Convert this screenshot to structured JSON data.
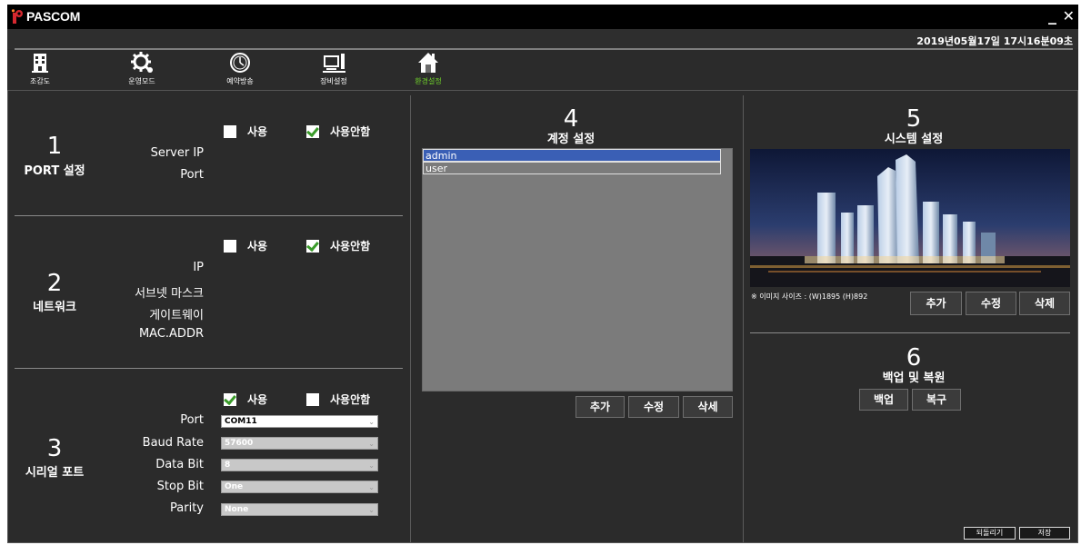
{
  "app": {
    "logo": "PASCOM",
    "minimize": "_",
    "close": "✕",
    "datetime": "2019년05월17일 17시16분09초"
  },
  "nav": {
    "items": [
      {
        "label": "조감도",
        "icon": "building-icon"
      },
      {
        "label": "운영모드",
        "icon": "gear-icon"
      },
      {
        "label": "예약방송",
        "icon": "clock-icon"
      },
      {
        "label": "장비설정",
        "icon": "monitor-icon"
      },
      {
        "label": "환경설정",
        "icon": "home-icon"
      }
    ],
    "active": "환경설정"
  },
  "port": {
    "number": "1",
    "title": "PORT 설정",
    "use": "사용",
    "nouse": "사용안함",
    "use_checked": false,
    "nouse_checked": true,
    "labels": [
      "Server IP",
      "Port"
    ]
  },
  "network": {
    "number": "2",
    "title": "네트워크",
    "use": "사용",
    "nouse": "사용안함",
    "use_checked": false,
    "nouse_checked": true,
    "labels": [
      "IP",
      "서브넷 마스크",
      "게이트웨이",
      "MAC.ADDR"
    ]
  },
  "serial": {
    "number": "3",
    "title": "시리얼 포트",
    "use": "사용",
    "nouse": "사용안함",
    "use_checked": true,
    "nouse_checked": false,
    "fields": [
      {
        "label": "Port",
        "value": "COM11"
      },
      {
        "label": "Baud Rate",
        "value": "57600"
      },
      {
        "label": "Data Bit",
        "value": "8"
      },
      {
        "label": "Stop Bit",
        "value": "One"
      },
      {
        "label": "Parity",
        "value": "None"
      }
    ]
  },
  "account": {
    "number": "4",
    "title": "계정 설정",
    "users": [
      "admin",
      "user"
    ],
    "selected": "admin",
    "add": "추가",
    "edit": "수정",
    "delete": "삭세"
  },
  "system": {
    "number": "5",
    "title": "시스템 설정",
    "image_note": "※ 이미지 사이즈 : (W)1895 (H)892",
    "add": "추가",
    "edit": "수정",
    "delete": "삭제"
  },
  "backup": {
    "number": "6",
    "title": "백업 및 복원",
    "backup": "백업",
    "restore": "복구"
  },
  "footer": {
    "revert": "되돌리기",
    "save": "저장"
  },
  "colors": {
    "background": "#2b2b2b",
    "accent": "#6fd12b",
    "selection": "#3a5fb5"
  }
}
